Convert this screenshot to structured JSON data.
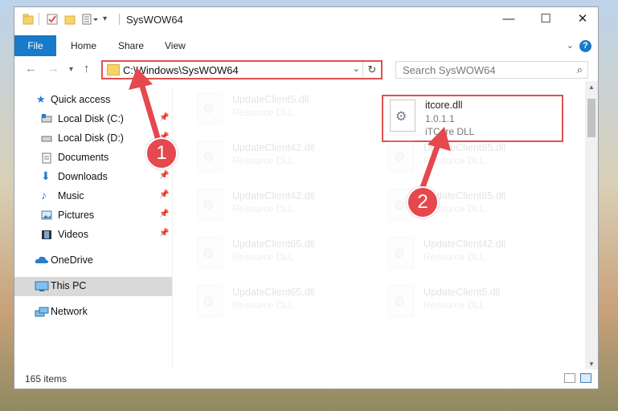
{
  "window": {
    "title": "SysWOW64",
    "minimize_glyph": "—",
    "maximize_glyph": "☐",
    "close_glyph": "✕"
  },
  "ribbon": {
    "tabs": [
      "File",
      "Home",
      "Share",
      "View"
    ],
    "help_glyph": "?"
  },
  "nav": {
    "address": "C:\\Windows\\SysWOW64",
    "search_placeholder": "Search SysWOW64"
  },
  "sidebar": {
    "items": [
      {
        "label": "Quick access",
        "icon": "star-icon",
        "pinned": false
      },
      {
        "label": "Local Disk (C:)",
        "icon": "drive-icon",
        "pinned": true
      },
      {
        "label": "Local Disk (D:)",
        "icon": "drive-icon",
        "pinned": true
      },
      {
        "label": "Documents",
        "icon": "documents-icon",
        "pinned": true
      },
      {
        "label": "Downloads",
        "icon": "download-icon",
        "pinned": true
      },
      {
        "label": "Music",
        "icon": "music-icon",
        "pinned": true
      },
      {
        "label": "Pictures",
        "icon": "pictures-icon",
        "pinned": true
      },
      {
        "label": "Videos",
        "icon": "videos-icon",
        "pinned": true
      },
      {
        "label": "OneDrive",
        "icon": "cloud-icon",
        "pinned": false
      },
      {
        "label": "This PC",
        "icon": "computer-icon",
        "pinned": false,
        "selected": true
      },
      {
        "label": "Network",
        "icon": "network-icon",
        "pinned": false
      }
    ]
  },
  "files": [
    {
      "name": "UpdateClient5.dll",
      "type": "Resource DLL"
    },
    {
      "name": "itcore.dll",
      "version": "1.0.1.1",
      "type": "iTCore DLL",
      "highlighted": true
    },
    {
      "name": "UpdateClient42.dll",
      "type": "Resource DLL"
    },
    {
      "name": "UpdateClient65.dll",
      "type": "Resource DLL"
    },
    {
      "name": "UpdateClient42.dll",
      "type": "Resource DLL"
    },
    {
      "name": "UpdateClient65.dll",
      "type": "Resource DLL"
    },
    {
      "name": "UpdateClient65.dll",
      "type": "Resource DLL"
    },
    {
      "name": "UpdateClient42.dll",
      "type": "Resource DLL"
    },
    {
      "name": "UpdateClient65.dll",
      "type": "Resource DLL"
    },
    {
      "name": "UpdateClient5.dll",
      "type": "Resource DLL"
    }
  ],
  "status": {
    "item_count": "165 items"
  },
  "annotations": {
    "step1": "1",
    "step2": "2",
    "color": "#e5484d"
  }
}
